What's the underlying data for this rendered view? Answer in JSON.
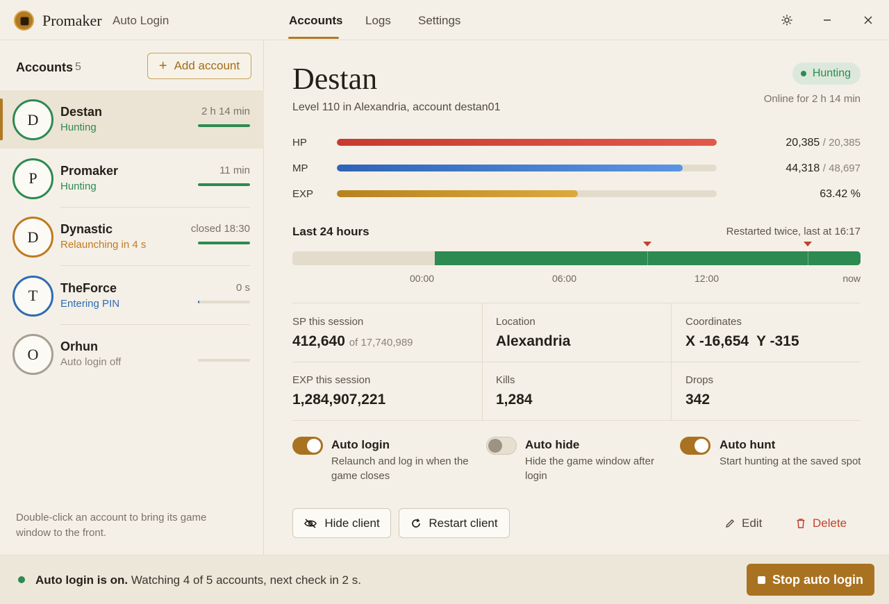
{
  "titlebar": {
    "app_name": "Promaker",
    "app_sub": "Auto Login",
    "tabs": [
      "Accounts",
      "Logs",
      "Settings"
    ],
    "icons": [
      "sun-icon",
      "minimize-icon",
      "close-icon"
    ]
  },
  "sidebar": {
    "title": "Accounts",
    "count": "5",
    "add_label": "Add account",
    "hint": "Double-click an account to bring its game window to the front.",
    "accounts": [
      {
        "initial": "D",
        "name": "Destan",
        "status": "Hunting",
        "time": "2 h 14 min",
        "progress": 1.0,
        "color": "#2d8a51"
      },
      {
        "initial": "P",
        "name": "Promaker",
        "status": "Hunting",
        "time": "11 min",
        "progress": 1.0,
        "color": "#2d8a51"
      },
      {
        "initial": "D",
        "name": "Dynastic",
        "status": "Relaunching in 4 s",
        "time": "closed 18:30",
        "progress": 1.0,
        "color": "#c07a1f"
      },
      {
        "initial": "T",
        "name": "TheForce",
        "status": "Entering PIN",
        "time": "0 s",
        "progress": 0.03,
        "color": "#2f6bb3"
      },
      {
        "initial": "O",
        "name": "Orhun",
        "status": "Auto login off",
        "time": "",
        "progress": 0,
        "color": "#a79f92"
      }
    ]
  },
  "detail": {
    "name": "Destan",
    "subtitle": "Level 110 in Alexandria, account destan01",
    "status": "Hunting",
    "online": "Online for 2 h 14 min",
    "stats": {
      "hp": {
        "label": "HP",
        "value": "20,385",
        "max": "/ 20,385",
        "fraction": 1.0
      },
      "mp": {
        "label": "MP",
        "value": "44,318",
        "max": "/ 48,697",
        "fraction": 0.91
      },
      "exp": {
        "label": "EXP",
        "value": "63.42 %",
        "fraction": 0.6342
      }
    },
    "timeline": {
      "title": "Last 24 hours",
      "note": "Restarted twice, last at 16:17",
      "ticks": [
        "00:00",
        "06:00",
        "12:00",
        "now"
      ],
      "online_from": 0.25,
      "restarts": [
        0.625,
        0.907
      ]
    },
    "cells": {
      "sp": {
        "label": "SP this session",
        "value": "412,640",
        "of": "of 17,740,989"
      },
      "location": {
        "label": "Location",
        "value": "Alexandria"
      },
      "coords": {
        "label": "Coordinates",
        "x": "X -16,654",
        "y": "Y -315"
      },
      "exp_session": {
        "label": "EXP this session",
        "value": "1,284,907,221"
      },
      "kills": {
        "label": "Kills",
        "value": "1,284"
      },
      "drops": {
        "label": "Drops",
        "value": "342"
      }
    },
    "options": {
      "auto_login": {
        "title": "Auto login",
        "desc": "Relaunch and log in when the game closes",
        "on": true
      },
      "auto_hide": {
        "title": "Auto hide",
        "desc": "Hide the game window after login",
        "on": false
      },
      "auto_hunt": {
        "title": "Auto hunt",
        "desc": "Start hunting at the saved spot",
        "on": true
      }
    },
    "actions": {
      "hide": "Hide client",
      "restart": "Restart client",
      "edit": "Edit",
      "delete": "Delete"
    }
  },
  "footer": {
    "status_bold": "Auto login is on.",
    "status_text": "Watching 4 of 5 accounts, next check in 2 s.",
    "stop_label": "Stop auto login"
  },
  "colors": {
    "accent": "#a97220",
    "green": "#2d8a51",
    "red": "#c0422e",
    "blue": "#2f6bb3"
  }
}
